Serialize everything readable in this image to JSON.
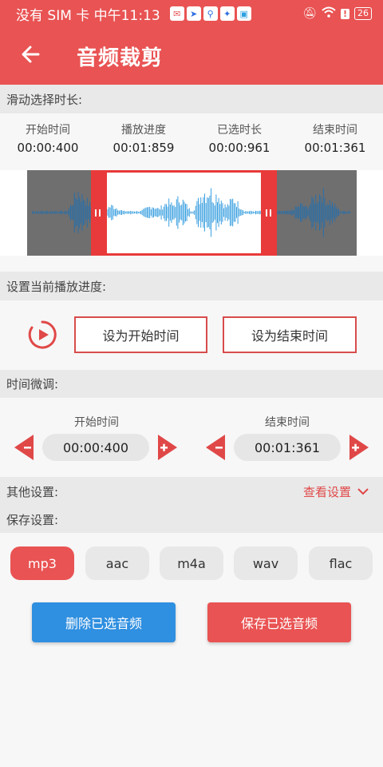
{
  "status": {
    "carrier": "没有 SIM 卡 中午11:13",
    "battery": "26"
  },
  "app_bar": {
    "title": "音频裁剪"
  },
  "sections": {
    "slide": "滑动选择时长:",
    "playback": "设置当前播放进度:",
    "fine_tune": "时间微调:",
    "other": "其他设置:",
    "save": "保存设置:"
  },
  "info": [
    {
      "label": "开始时间",
      "value": "00:00:400"
    },
    {
      "label": "播放进度",
      "value": "00:01:859"
    },
    {
      "label": "已选时长",
      "value": "00:00:961"
    },
    {
      "label": "结束时间",
      "value": "00:01:361"
    }
  ],
  "playback_buttons": {
    "set_start": "设为开始时间",
    "set_end": "设为结束时间"
  },
  "fine_tune": {
    "start_label": "开始时间",
    "start_value": "00:00:400",
    "end_label": "结束时间",
    "end_value": "00:01:361"
  },
  "other_settings": {
    "view": "查看设置"
  },
  "formats": [
    "mp3",
    "aac",
    "m4a",
    "wav",
    "flac"
  ],
  "selected_format": "mp3",
  "actions": {
    "delete": "删除已选音频",
    "save": "保存已选音频"
  },
  "colors": {
    "accent": "#e95353",
    "blue": "#2f8fe0",
    "wave": "#3aa0e0"
  }
}
